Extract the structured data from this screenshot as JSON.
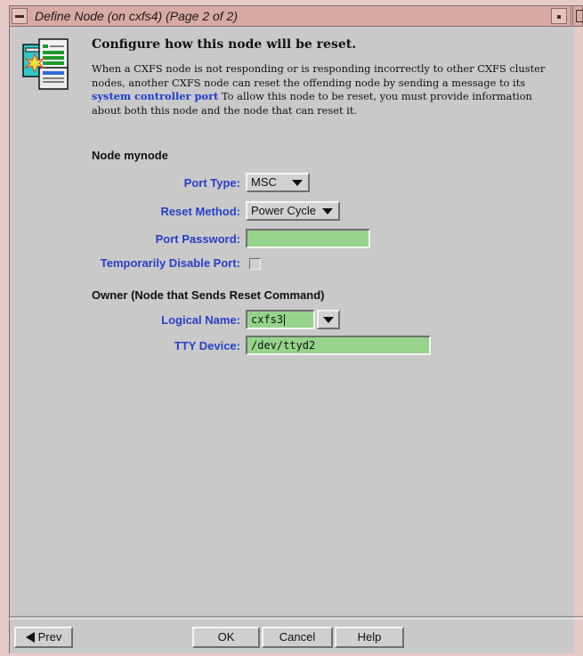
{
  "window": {
    "title": "Define Node (on cxfs4) (Page 2 of 2)"
  },
  "intro": {
    "heading": "Configure how this node will be reset.",
    "text_before_link": "When a CXFS node is not responding or is responding incorrectly to other CXFS cluster nodes, another CXFS node can reset the offending node by sending a message to its ",
    "link_text": "system controller port",
    "text_after_link": "   To allow this node to be reset, you must provide information about both this node and the node that can reset it."
  },
  "node_section": {
    "title": "Node mynode",
    "port_type": {
      "label": "Port Type:",
      "value": "MSC"
    },
    "reset_method": {
      "label": "Reset Method:",
      "value": "Power Cycle"
    },
    "port_password": {
      "label": "Port Password:",
      "value": ""
    },
    "disable_port": {
      "label": "Temporarily Disable Port:",
      "checked": false
    }
  },
  "owner_section": {
    "title": "Owner (Node that Sends Reset Command)",
    "logical_name": {
      "label": "Logical Name:",
      "value": "cxfs3"
    },
    "tty_device": {
      "label": "TTY Device:",
      "value": "/dev/ttyd2"
    }
  },
  "buttons": {
    "prev": "Prev",
    "ok": "OK",
    "cancel": "Cancel",
    "help": "Help"
  },
  "colors": {
    "label_blue": "#2740c8",
    "field_green": "#96d48c",
    "titlebar": "#d9aaa4",
    "background": "#c9c9c9"
  },
  "icons": {
    "window_menu": "window-menu-icon",
    "minimize": "minimize-icon",
    "wizard": "document-wizard-icon",
    "prev_arrow": "left-triangle-icon",
    "dropdown": "triangle-down-icon"
  }
}
